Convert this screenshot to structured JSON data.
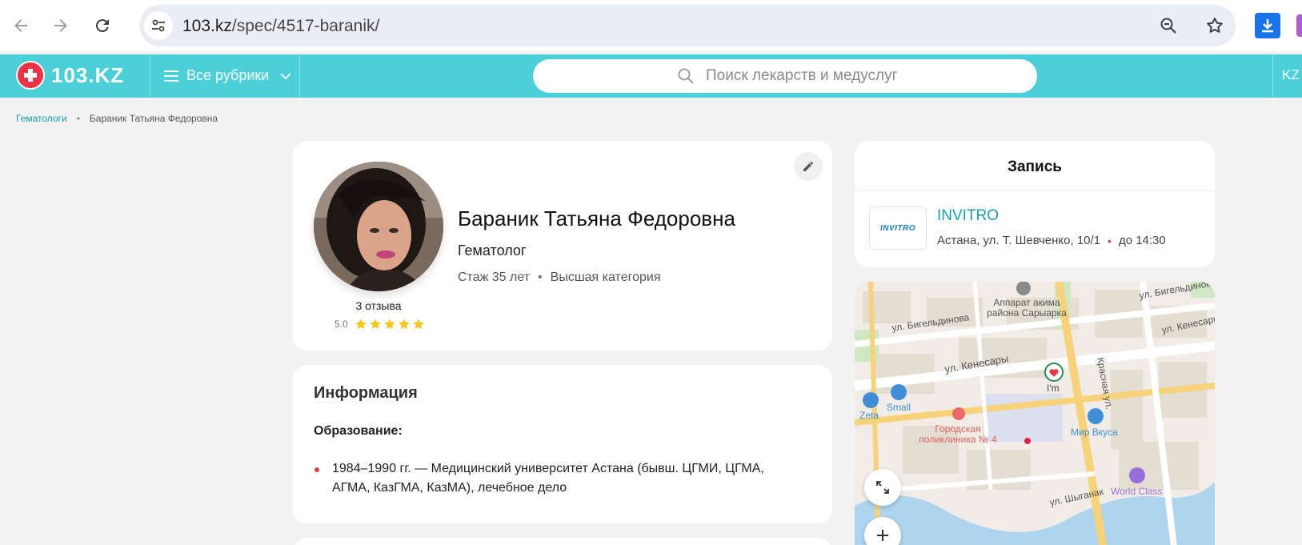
{
  "browser": {
    "url_host": "103.kz",
    "url_path": "/spec/4517-baranik/"
  },
  "header": {
    "logo_text": "103.KZ",
    "rubrics_label": "Все рубрики",
    "search_placeholder": "Поиск лекарств и медуслуг",
    "lang_label": "KZ"
  },
  "breadcrumb": {
    "parent": "Гематологи",
    "separator": "•",
    "current": "Бараник Татьяна Федоровна"
  },
  "profile": {
    "name": "Бараник Татьяна Федоровна",
    "specialty": "Гематолог",
    "experience": "Стаж 35 лет",
    "meta_separator": "•",
    "category": "Высшая категория",
    "reviews_count": "3 отзыва",
    "rating_score": "5.0",
    "rating_stars": 5
  },
  "information": {
    "title": "Информация",
    "education_title": "Образование:",
    "education_items": [
      "1984–1990 гг. — Медицинский университет Астана (бывш. ЦГМИ, ЦГМА, АГМА, КазГМА, КазМА), лечебное дело"
    ]
  },
  "booking": {
    "title": "Запись",
    "clinic_logo_text": "INVITRO",
    "clinic_name": "INVITRO",
    "clinic_address": "Астана, ул. Т. Шевченко, 10/1",
    "clinic_hours": "до 14:30"
  },
  "map": {
    "labels": {
      "street_bigeldinova_left": "ул. Бигельдинова",
      "street_bigeldinova_right": "ул. Бигельдинова",
      "street_kenesary": "ул. Кенесары",
      "street_kenesary_right": "ул. Кенесары",
      "street_krasnaya": "Красная ул.",
      "street_shyganak": "ул. Шыганак",
      "akimat": "Аппарат акима района Сарыарка",
      "small": "Small",
      "zeta": "Zeta",
      "im": "I'm",
      "polyclinic": "Городская поликлиника № 4",
      "mir_vkusa": "Мир Вкуса",
      "world_class": "World Class"
    }
  },
  "colors": {
    "brand_header": "#4bcfd9",
    "link": "#1a9fb0",
    "accent_red": "#e63946",
    "star": "#f5c518"
  }
}
